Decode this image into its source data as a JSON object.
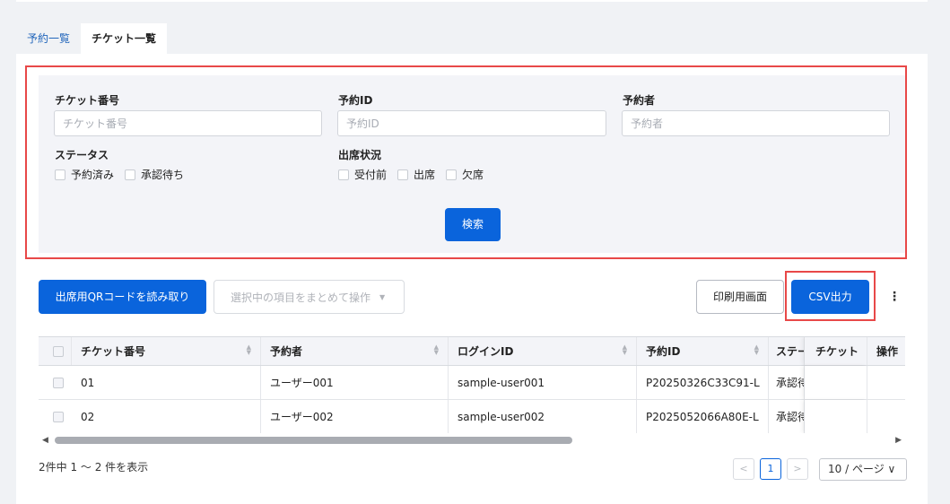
{
  "tabs": [
    {
      "label": "予約一覧",
      "active": false
    },
    {
      "label": "チケット一覧",
      "active": true
    }
  ],
  "filter": {
    "ticket_no": {
      "label": "チケット番号",
      "placeholder": "チケット番号",
      "value": ""
    },
    "reservation_id": {
      "label": "予約ID",
      "placeholder": "予約ID",
      "value": ""
    },
    "reserver": {
      "label": "予約者",
      "placeholder": "予約者",
      "value": ""
    },
    "status": {
      "label": "ステータス",
      "options": [
        "予約済み",
        "承認待ち"
      ]
    },
    "attendance": {
      "label": "出席状況",
      "options": [
        "受付前",
        "出席",
        "欠席"
      ]
    },
    "search_button": "検索"
  },
  "toolbar": {
    "scan_qr": "出席用QRコードを読み取り",
    "bulk_action": "選択中の項目をまとめて操作",
    "print_screen": "印刷用画面",
    "csv_export": "CSV出力",
    "more": "⋮"
  },
  "table": {
    "columns": [
      "チケット番号",
      "予約者",
      "ログインID",
      "予約ID",
      "ステータス",
      "チケット",
      "操作"
    ],
    "rows": [
      {
        "ticket_no": "01",
        "reserver": "ユーザー001",
        "login_id": "sample-user001",
        "reservation_id": "P20250326C33C91-L",
        "status": "承認待ち",
        "ticket": "",
        "action": ""
      },
      {
        "ticket_no": "02",
        "reserver": "ユーザー002",
        "login_id": "sample-user002",
        "reservation_id": "P2025052066A80E-L",
        "status": "承認待ち",
        "ticket": "",
        "action": ""
      }
    ]
  },
  "pagination": {
    "summary": "2件中 1 〜 2 件を表示",
    "prev": "<",
    "current_page": "1",
    "next": ">",
    "page_size": "10 / ページ ∨"
  },
  "colors": {
    "primary": "#0a64dc",
    "highlight": "#e84848"
  }
}
